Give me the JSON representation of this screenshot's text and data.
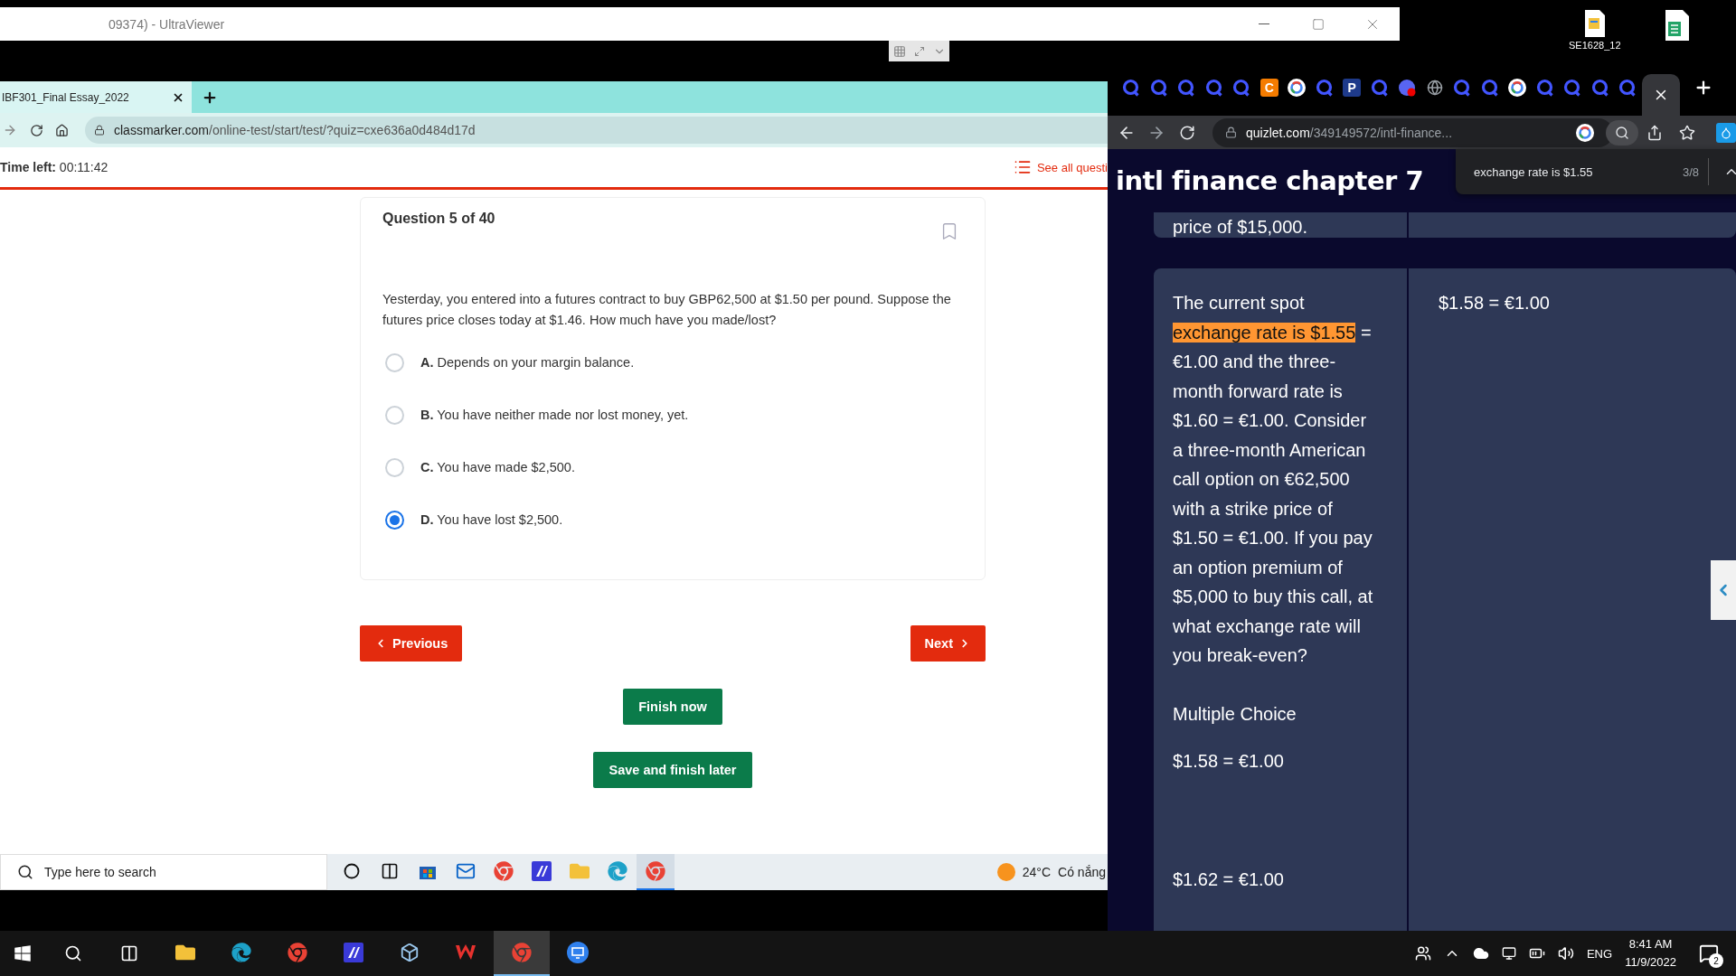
{
  "remote_window": {
    "title": "09374) - UltraViewer"
  },
  "remote_browser": {
    "tab_title": "IBF301_Final Essay_2022",
    "url_host": "classmarker.com",
    "url_path": "/online-test/start/test/?quiz=cxe636a0d484d17d"
  },
  "quiz": {
    "timer": "**Time left:** 00:11:42",
    "see_all": "See all questi",
    "question_title": "Question 5 of 40",
    "question": "Yesterday, you entered into a futures contract to buy GBP62,500 at $1.50 per pound. Suppose the futures price closes today at $1.46. How much have you made/lost?",
    "options": [
      {
        "text": "**A.** Depends on your margin balance.",
        "selected": false
      },
      {
        "text": "**B.** You have neither made nor lost money, yet.",
        "selected": false
      },
      {
        "text": "**C.** You have made $2,500.",
        "selected": false
      },
      {
        "text": "**D.** You have lost $2,500.",
        "selected": true
      }
    ],
    "previous": "Previous",
    "next": "Next",
    "finish": "Finish now",
    "save_later": "Save and finish later"
  },
  "remote_taskbar": {
    "search_placeholder": "Type here to search",
    "apps": [
      {
        "kind": "cortana",
        "active": false
      },
      {
        "kind": "taskview",
        "active": false
      },
      {
        "kind": "store",
        "active": false
      },
      {
        "kind": "mail",
        "active": false
      },
      {
        "kind": "chrome",
        "active": false
      },
      {
        "kind": "bluebox",
        "active": false
      },
      {
        "kind": "folder",
        "active": false
      },
      {
        "kind": "edge",
        "active": false
      },
      {
        "kind": "chrome",
        "active": true
      }
    ],
    "temperature": "24°C",
    "weather": "Có nắng"
  },
  "desktop_icons": [
    {
      "kind": "document",
      "label": "SE1628_12"
    },
    {
      "kind": "sheet"
    }
  ],
  "quizlet_browser": {
    "tabs": [
      {
        "kind": "quizlet",
        "selected": false
      },
      {
        "kind": "quizlet",
        "selected": false
      },
      {
        "kind": "quizlet",
        "selected": false
      },
      {
        "kind": "quizlet",
        "selected": false
      },
      {
        "kind": "quizlet",
        "selected": false
      },
      {
        "kind": "letter",
        "letter": "C",
        "color": "#f57c00",
        "selected": false
      },
      {
        "kind": "google",
        "selected": false
      },
      {
        "kind": "quizlet",
        "selected": false
      },
      {
        "kind": "letter",
        "letter": "P",
        "color": "#1e3a8a",
        "selected": false
      },
      {
        "kind": "quizlet",
        "selected": false
      },
      {
        "kind": "discord",
        "selected": false
      },
      {
        "kind": "globe",
        "selected": false
      },
      {
        "kind": "quizlet",
        "selected": false
      },
      {
        "kind": "quizlet",
        "selected": false
      },
      {
        "kind": "google",
        "selected": false
      },
      {
        "kind": "quizlet",
        "selected": false
      },
      {
        "kind": "quizlet",
        "selected": false
      },
      {
        "kind": "quizlet",
        "selected": false
      },
      {
        "kind": "quizlet",
        "selected": false
      },
      {
        "kind": "close",
        "selected": true
      }
    ],
    "url_host": "quizlet.com",
    "url_path": "/349149572/intl-finance...",
    "find_query": "exchange rate is $1.55",
    "find_count": "3/8"
  },
  "quizlet": {
    "set_title": "intl finance chapter 7",
    "cards": [
      {
        "term": [
          {
            "text": "price of $15,000.",
            "highlight": false
          }
        ]
      },
      {
        "term": [
          {
            "text": "The current spot ",
            "highlight": false
          },
          {
            "text": "exchange rate is $1.55",
            "highlight": true
          },
          {
            "text": " = €1.00 and the three-month forward rate is $1.60 = €1.00. Consider a three-month American call option on €62,500 with a strike price of $1.50 = €1.00. If you pay an option premium of $5,000 to buy this call, at what exchange rate will you break-even?",
            "highlight": false
          }
        ],
        "question_type": "Multiple Choice",
        "choices": [
          "$1.58 = €1.00",
          "$1.62 = €1.00"
        ],
        "definition": "$1.58 = €1.00"
      }
    ]
  },
  "local_taskbar": {
    "apps": [
      {
        "kind": "folder",
        "active": false
      },
      {
        "kind": "edge",
        "active": false
      },
      {
        "kind": "chrome",
        "active": false
      },
      {
        "kind": "bluebox",
        "active": false
      },
      {
        "kind": "cube",
        "active": false
      },
      {
        "kind": "wps",
        "active": false
      },
      {
        "kind": "chrome",
        "active": true
      },
      {
        "kind": "viewer",
        "active": false
      }
    ],
    "language": "ENG",
    "time": "8:41 AM",
    "date": "11/9/2022",
    "notifications": "2"
  }
}
